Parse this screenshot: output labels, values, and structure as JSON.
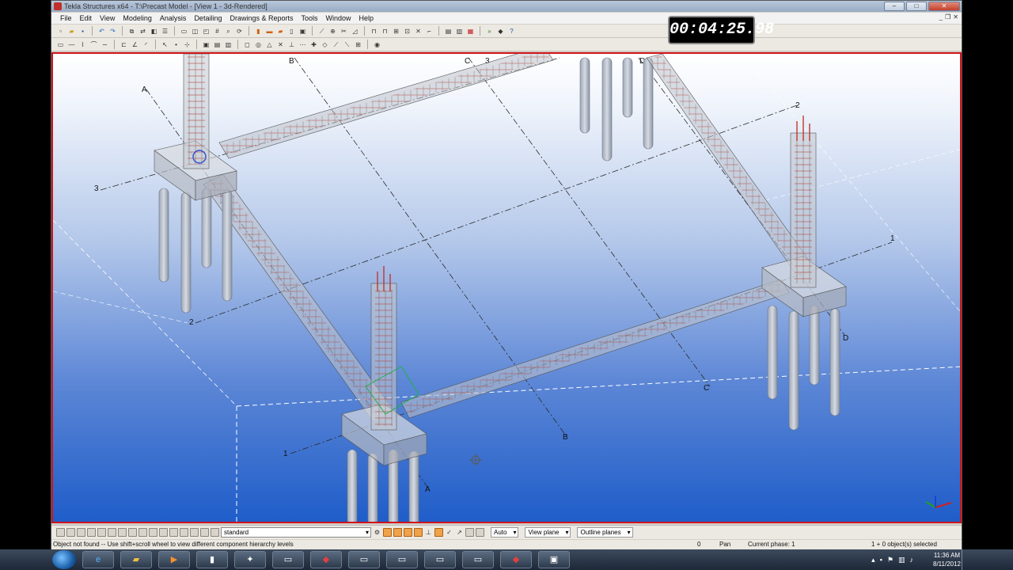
{
  "window": {
    "title": "Tekla Structures x64 - T:\\Precast Model - [View 1 - 3d-Rendered]",
    "min_label": "–",
    "max_label": "□",
    "close_label": "✕"
  },
  "menu": [
    "File",
    "Edit",
    "View",
    "Modeling",
    "Analysis",
    "Detailing",
    "Drawings & Reports",
    "Tools",
    "Window",
    "Help"
  ],
  "timer": "00:04:25.98",
  "viewport": {
    "grid_labels": {
      "A_top": "A",
      "B_top": "B",
      "C_top": "C",
      "3_top": "3",
      "D_top": "D",
      "2_right": "2",
      "1_right": "1",
      "3_left": "3",
      "2_left": "2",
      "1_left": "1",
      "D_right": "D",
      "C_bottom": "C",
      "B_bottom": "B",
      "A_bottom": "A"
    }
  },
  "selection": {
    "filter": "standard",
    "snap_mode": "Auto",
    "plane_mode": "View plane",
    "outline_mode": "Outline planes"
  },
  "status": {
    "message": "Object not found -- Use shift+scroll wheel to view different component hierarchy levels",
    "count": "0",
    "mode": "Pan",
    "phase": "Current phase: 1",
    "selected": "1 + 0 object(s) selected"
  },
  "taskbar": {
    "time": "11:36 AM",
    "date": "8/11/2012"
  },
  "colors": {
    "viewport_border": "#d0141c",
    "sky_bottom": "#1f5dc9",
    "rebar": "#c0392b"
  }
}
